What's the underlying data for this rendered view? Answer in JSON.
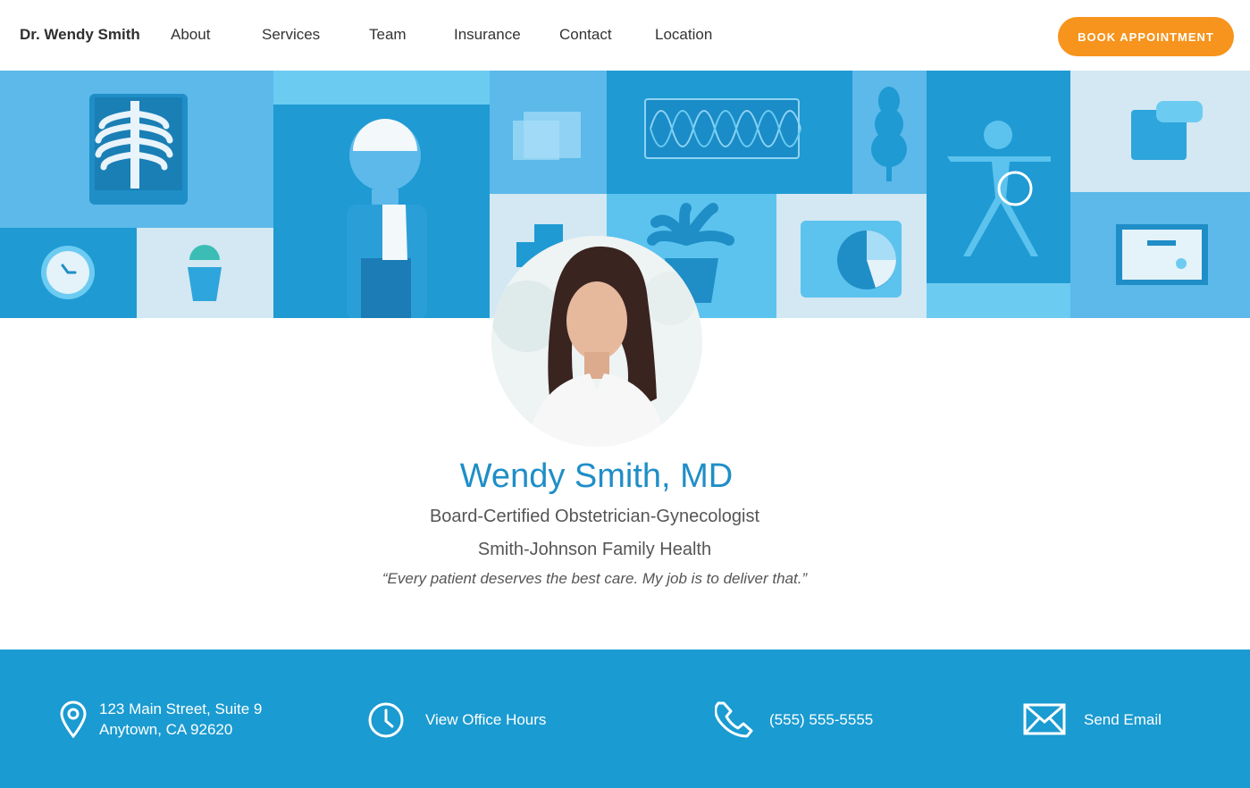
{
  "nav": {
    "brand": "Dr. Wendy Smith",
    "links": [
      "About",
      "Services",
      "Team",
      "Insurance",
      "Contact",
      "Location"
    ],
    "cta": "BOOK APPOINTMENT"
  },
  "colors": {
    "accent": "#1f8ec7",
    "cta": "#f7941d",
    "footer_bg": "#1a9bd1"
  },
  "profile": {
    "name": "Wendy Smith, MD",
    "specialty": "Board-Certified Obstetrician-Gynecologist",
    "practice": "Smith-Johnson Family Health",
    "quote": "“Every patient deserves the best care. My job is to deliver that.”"
  },
  "footer": {
    "address_line1": "123 Main Street, Suite 9",
    "address_line2": "Anytown, CA 92620",
    "hours": "View Office Hours",
    "phone": "(555) 555-5555",
    "email": "Send Email"
  },
  "icons": [
    "map-pin-icon",
    "clock-icon",
    "phone-icon",
    "envelope-icon"
  ]
}
